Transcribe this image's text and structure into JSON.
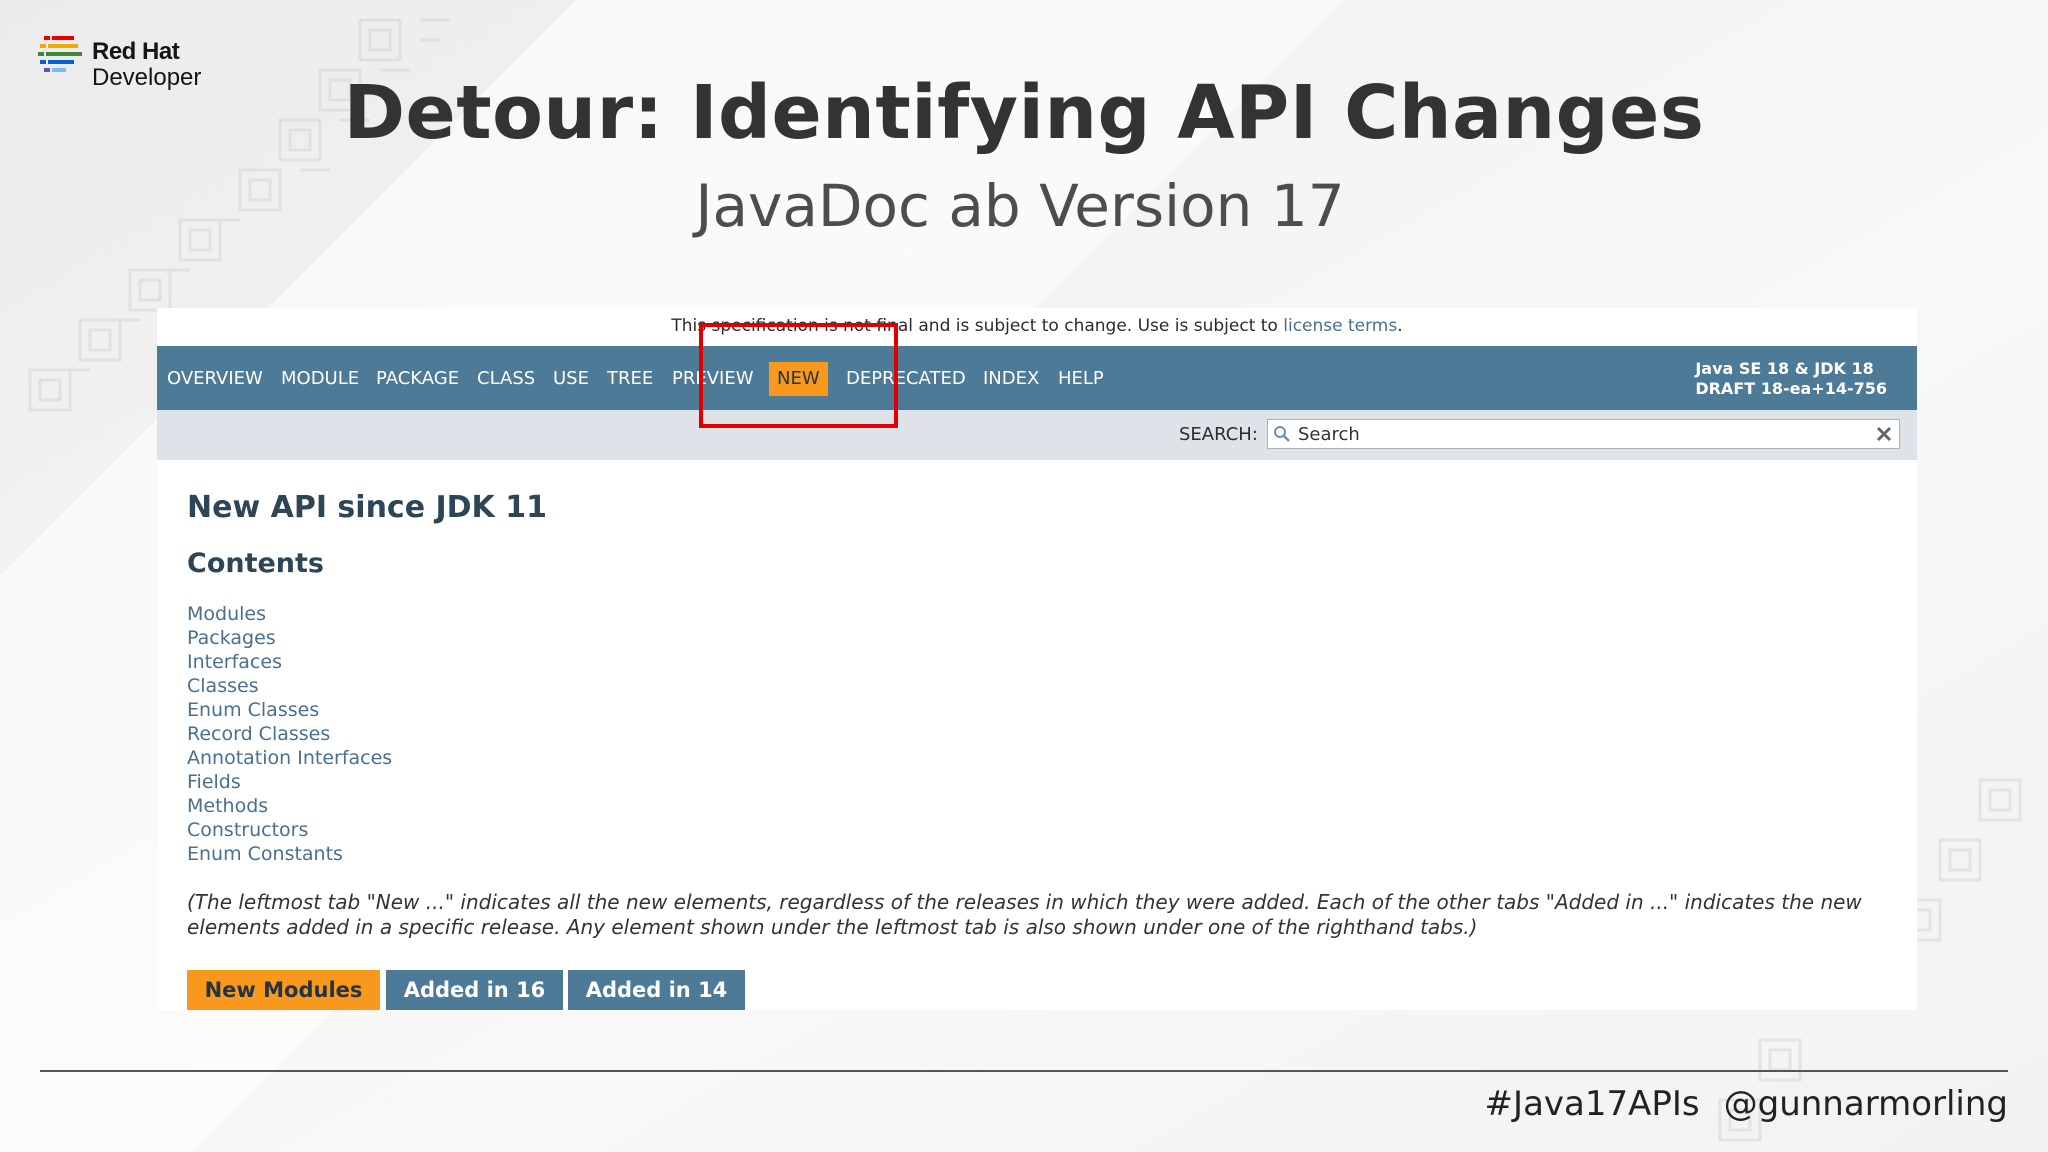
{
  "brand": {
    "line1": "Red Hat",
    "line2": "Developer"
  },
  "title": "Detour: Identifying API Changes",
  "subtitle": "JavaDoc ab Version 17",
  "javadoc": {
    "notice_prefix": "This specification is not final and is subject to change. Use is subject to ",
    "notice_link": "license terms",
    "notice_suffix": ".",
    "nav": [
      "OVERVIEW",
      "MODULE",
      "PACKAGE",
      "CLASS",
      "USE",
      "TREE",
      "PREVIEW",
      "NEW",
      "DEPRECATED",
      "INDEX",
      "HELP"
    ],
    "active_nav": "NEW",
    "about_line1": "Java SE 18 & JDK 18",
    "about_line2": "DRAFT 18-ea+14-756",
    "search_label": "SEARCH:",
    "search_placeholder": "Search",
    "heading": "New API since JDK 11",
    "contents_heading": "Contents",
    "contents": [
      "Modules",
      "Packages",
      "Interfaces",
      "Classes",
      "Enum Classes",
      "Record Classes",
      "Annotation Interfaces",
      "Fields",
      "Methods",
      "Constructors",
      "Enum Constants"
    ],
    "explanation": "(The leftmost tab \"New ...\" indicates all the new elements, regardless of the releases in which they were added. Each of the other tabs \"Added in ...\" indicates the new elements added in a specific release. Any element shown under the leftmost tab is also shown under one of the righthand tabs.)",
    "tabs": [
      "New Modules",
      "Added in 16",
      "Added in 14"
    ],
    "active_tab": "New Modules"
  },
  "footer": {
    "hashtag": "#Java17APIs",
    "handle": "@gunnarmorling"
  },
  "colors": {
    "nav_bg": "#4d7a97",
    "accent": "#f8981d",
    "highlight": "#e00000",
    "link": "#4a6f8f"
  }
}
